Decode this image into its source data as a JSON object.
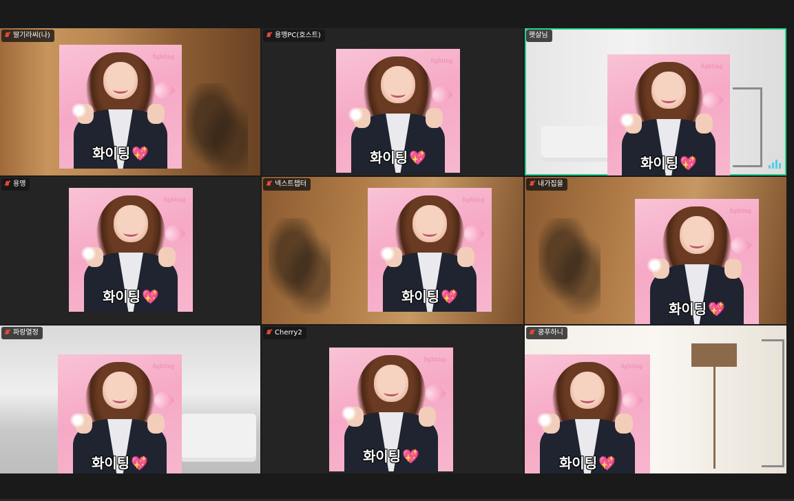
{
  "window": {
    "app": "video-meeting-gallery-view"
  },
  "sticker": {
    "caption": "화이팅",
    "caption_emoji": "💖",
    "corner_text": "fighting"
  },
  "participants": [
    {
      "name": "딸기라씨(나)",
      "mic": "muted",
      "background": "warm-room-with-plant"
    },
    {
      "name": "용맹PC(호스트)",
      "mic": "muted",
      "background": "dark"
    },
    {
      "name": "햇살님",
      "mic": "muted",
      "background": "white-living-room",
      "active_speaker": true
    },
    {
      "name": "용맹",
      "mic": "muted",
      "background": "dark"
    },
    {
      "name": "넥스트챕터",
      "mic": "muted",
      "background": "warm-room-with-plant"
    },
    {
      "name": "내가집을",
      "mic": "muted",
      "background": "warm-room-with-plant"
    },
    {
      "name": "파랑열정",
      "mic": "muted",
      "background": "bright-office"
    },
    {
      "name": "Cherry2",
      "mic": "muted",
      "background": "dark"
    },
    {
      "name": "쿵푸하니",
      "mic": "muted",
      "background": "bright-room-with-lamp"
    }
  ],
  "colors": {
    "active_border": "#23d18b",
    "muted_mic": "#e04a3b",
    "audio_level": "#4fd0e9",
    "sticker_pink": "#f6a9c6"
  }
}
